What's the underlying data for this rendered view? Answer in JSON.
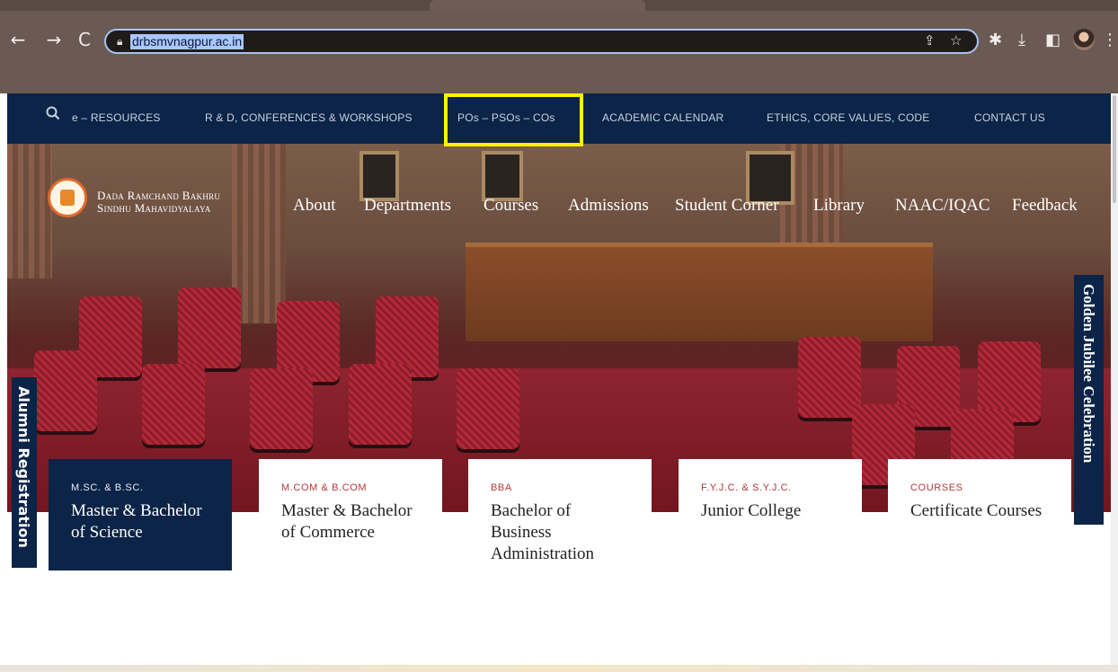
{
  "browser": {
    "url": "drbsmvnagpur.ac.in",
    "icons": [
      "back-icon",
      "forward-icon",
      "reload-icon",
      "lock-icon",
      "share-icon",
      "bookmark-star-icon",
      "extensions-icon",
      "download-icon",
      "side-panel-icon",
      "profile-avatar",
      "menu-icon"
    ]
  },
  "topbar": {
    "items": [
      "e – RESOURCES",
      "R & D, CONFERENCES & WORKSHOPS",
      "POs – PSOs – COs",
      "ACADEMIC CALENDAR",
      "ETHICS, CORE VALUES, CODE",
      "CONTACT US"
    ],
    "highlighted_color": "#fff200",
    "background": "#0b2447"
  },
  "header": {
    "college_line1": "Dada Ramchand Bakhru",
    "college_line2": "Sindhu Mahavidyalaya",
    "nav": [
      "About",
      "Departments",
      "Courses",
      "Admissions",
      "Student Corner",
      "Library",
      "NAAC/IQAC",
      "Feedback"
    ]
  },
  "side_tabs": {
    "left": "Alumni Registration",
    "right": "Golden Jubilee Celebration"
  },
  "cards": [
    {
      "tag": "M.SC. & B.SC.",
      "title": "Master & Bachelor of Science"
    },
    {
      "tag": "M.COM & B.COM",
      "title": "Master & Bachelor of Commerce"
    },
    {
      "tag": "BBA",
      "title": "Bachelor of Business Administration"
    },
    {
      "tag": "F.Y.J.C. & S.Y.J.C.",
      "title": "Junior College"
    },
    {
      "tag": "COURSES",
      "title": "Certificate Courses"
    }
  ]
}
